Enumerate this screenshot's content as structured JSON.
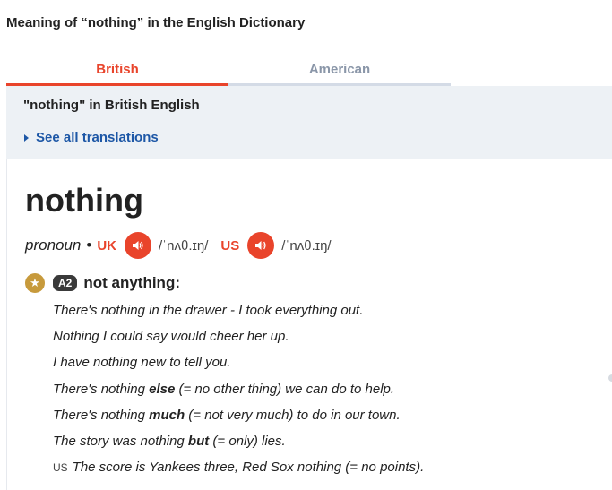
{
  "page": {
    "heading": "Meaning of “nothing” in the English Dictionary"
  },
  "tabs": [
    {
      "label": "British",
      "active": true
    },
    {
      "label": "American",
      "active": false
    }
  ],
  "panel": {
    "title": "\"nothing\" in British English",
    "see_all": "See all translations"
  },
  "entry": {
    "headword": "nothing",
    "part_of_speech": "pronoun",
    "separator": "•",
    "uk": {
      "label": "UK",
      "ipa": "/ˈnʌθ.ɪŋ/"
    },
    "us": {
      "label": "US",
      "ipa": "/ˈnʌθ.ɪŋ/"
    },
    "sense": {
      "level": "A2",
      "definition": "not anything:"
    },
    "examples": [
      {
        "pre": "There's nothing in the drawer - I took everything out."
      },
      {
        "pre": "Nothing I could say would cheer her up."
      },
      {
        "pre": "I have nothing new to tell you."
      },
      {
        "pre": "There's nothing ",
        "bold": "else",
        "post": " (= no other thing) we can do to help."
      },
      {
        "pre": "There's nothing ",
        "bold": "much",
        "post": " (= not very much) to do in our town."
      },
      {
        "pre": "The story was nothing ",
        "bold": "but",
        "post": " (= only) lies."
      },
      {
        "label": "US",
        "pre": "The score is Yankees three, Red Sox nothing (= no points)."
      }
    ]
  },
  "colors": {
    "accent": "#e9442b",
    "link": "#1d57a6",
    "panel_bg": "#edf1f5",
    "star": "#c79a3c"
  },
  "icons": {
    "speaker": "speaker-icon",
    "star": "star-icon",
    "caret": "caret-right-icon"
  }
}
